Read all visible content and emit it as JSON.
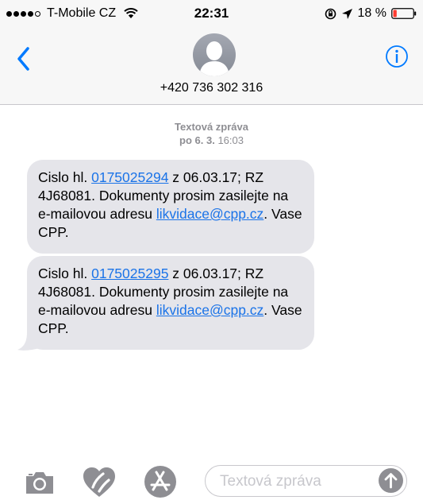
{
  "status_bar": {
    "carrier": "T-Mobile CZ",
    "time": "22:31",
    "battery": "18 %",
    "battery_level": 0.18,
    "signal_bars_filled": 4,
    "signal_bars_total": 5
  },
  "header": {
    "contact": "+420 736 302 316",
    "back_icon": "chevron-left-icon",
    "info_icon": "info-icon"
  },
  "conversation": {
    "service_label": "Textová zpráva",
    "date_day": "po 6. 3.",
    "date_time": "16:03",
    "messages": [
      {
        "prefix": "Cislo hl. ",
        "number": "0175025294",
        "mid": " z 06.03.17; RZ 4J68081. Dokumenty prosim zasilejte na e-mailovou adresu ",
        "email": "likvidace@cpp.cz",
        "suffix": ". Vase CPP."
      },
      {
        "prefix": "Cislo hl. ",
        "number": "0175025295",
        "mid": " z 06.03.17; RZ 4J68081. Dokumenty prosim zasilejte na e-mailovou adresu ",
        "email": "likvidace@cpp.cz",
        "suffix": ". Vase CPP."
      }
    ]
  },
  "toolbar": {
    "placeholder": "Textová zpráva",
    "icons": [
      "camera-icon",
      "digital-touch-heart-icon",
      "app-store-icon",
      "send-arrow-icon"
    ]
  },
  "colors": {
    "accent": "#007aff",
    "link": "#1a73e8",
    "bubble": "#e5e5ea",
    "battery_low": "#ff3b30",
    "meta_text": "#8e8e93"
  }
}
